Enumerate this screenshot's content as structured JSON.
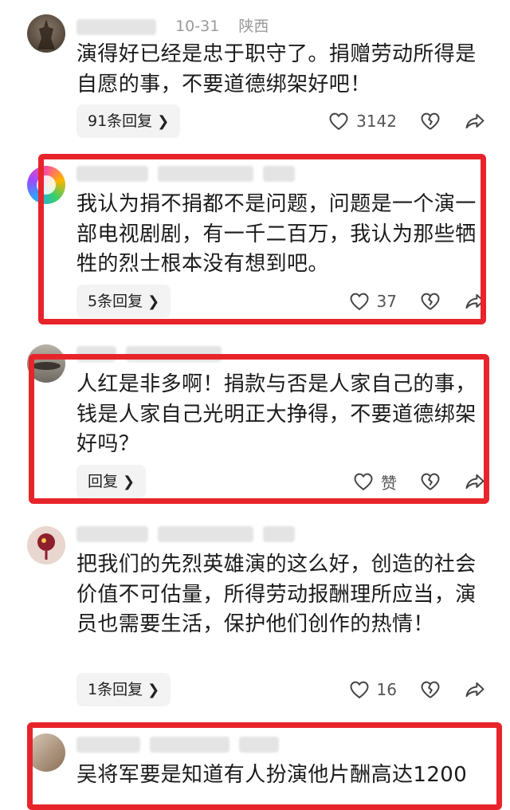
{
  "comments": [
    {
      "meta_date": "10-31",
      "meta_location": "陕西",
      "text": "演得好已经是忠于职守了。捐赠劳动所得是自愿的事，不要道德绑架好吧！",
      "reply_label": "91条回复",
      "likes": "3142"
    },
    {
      "meta_date": "",
      "meta_location": "",
      "text": "我认为捐不捐都不是问题，问题是一个演一部电视剧剧，有一千二百万，我认为那些牺牲的烈士根本没有想到吧。",
      "reply_label": "5条回复",
      "likes": "37"
    },
    {
      "meta_date": "",
      "meta_location": "",
      "text": "人红是非多啊！捐款与否是人家自己的事，钱是人家自己光明正大挣得，不要道德绑架好吗？",
      "reply_label": "回复",
      "likes": "赞"
    },
    {
      "meta_date": "",
      "meta_location": "",
      "text": "把我们的先烈英雄演的这么好，创造的社会价值不可估量，所得劳动报酬理所应当，演员也需要生活，保护他们创作的热情！",
      "reply_label": "1条回复",
      "likes": "16"
    },
    {
      "meta_date": "",
      "meta_location": "",
      "text": "吴将军要是知道有人扮演他片酬高达1200",
      "reply_label": "",
      "likes": ""
    }
  ],
  "icons": {
    "like": "heart-outline-icon",
    "dislike": "broken-heart-icon",
    "share": "share-arrow-icon",
    "chevron": "chevron-right-icon"
  },
  "colors": {
    "highlight_box": "#e8242b",
    "reply_bg": "#f3f3f3"
  }
}
